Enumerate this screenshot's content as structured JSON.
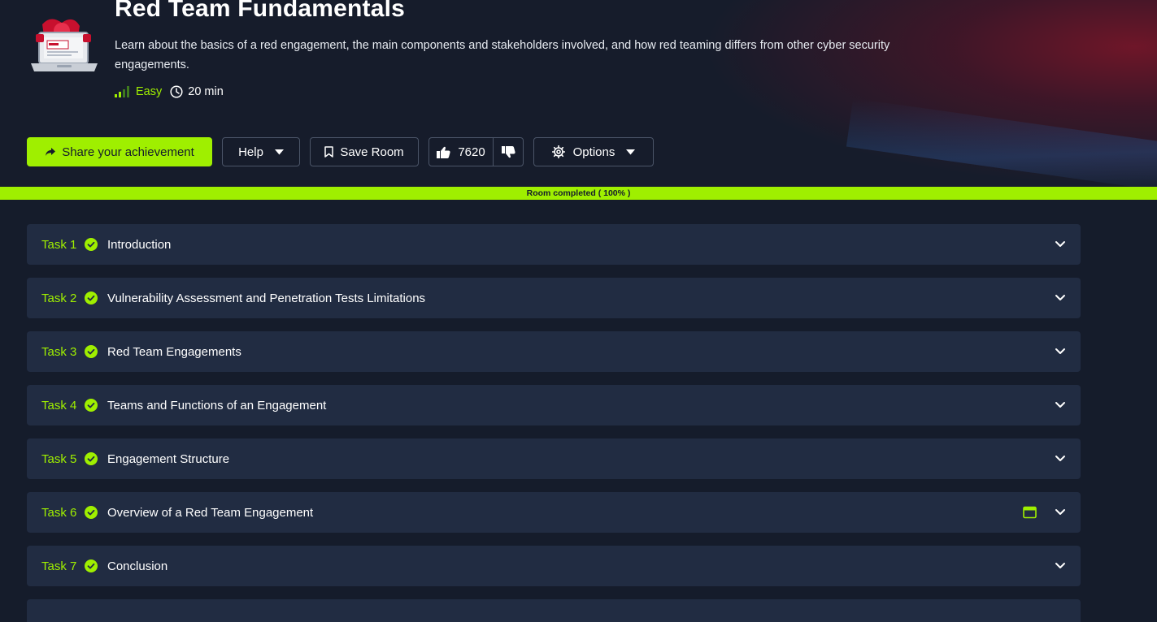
{
  "room": {
    "title": "Red Team Fundamentals",
    "description": "Learn about the basics of a red engagement, the main components and stakeholders involved, and how red teaming differs from other cyber security engagements.",
    "difficulty": "Easy",
    "duration": "20 min"
  },
  "actions": {
    "share_label": "Share your achievement",
    "help_label": "Help",
    "save_label": "Save Room",
    "upvotes": "7620",
    "options_label": "Options"
  },
  "progress": {
    "label": "Room completed ( 100% )",
    "percent": 100
  },
  "tasks": [
    {
      "num": "Task 1",
      "title": "Introduction"
    },
    {
      "num": "Task 2",
      "title": "Vulnerability Assessment and Penetration Tests Limitations"
    },
    {
      "num": "Task 3",
      "title": "Red Team Engagements"
    },
    {
      "num": "Task 4",
      "title": "Teams and Functions of an Engagement"
    },
    {
      "num": "Task 5",
      "title": "Engagement Structure"
    },
    {
      "num": "Task 6",
      "title": "Overview of a Red Team Engagement"
    },
    {
      "num": "Task 7",
      "title": "Conclusion"
    }
  ],
  "colors": {
    "accent": "#9fef00",
    "background": "#151c2b",
    "card": "#212c42"
  },
  "icons": [
    "room-logo-icon",
    "difficulty-bars-icon",
    "clock-icon",
    "share-icon",
    "caret-down-icon",
    "bookmark-icon",
    "thumbs-up-icon",
    "thumbs-down-icon",
    "gear-icon",
    "check-circle-icon",
    "chevron-down-icon",
    "browser-window-icon"
  ]
}
